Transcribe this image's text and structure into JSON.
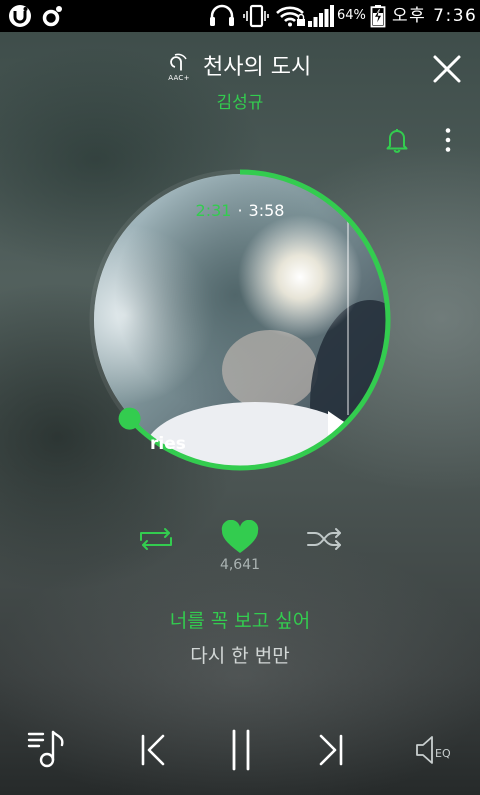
{
  "status_bar": {
    "battery_percent": "64%",
    "time": "오후 7:36",
    "icons": [
      "u-plus-icon",
      "music-notification-icon",
      "headset-icon",
      "phone-vibrate-icon",
      "wifi-lock-icon",
      "signal-icon",
      "battery-charging-icon"
    ]
  },
  "header": {
    "codec_badge": "AAC+",
    "song_title": "천사의 도시",
    "artist": "김성규",
    "icons": [
      "aac-icon",
      "close-icon",
      "bell-icon",
      "more-vertical-icon"
    ]
  },
  "player": {
    "elapsed": "2:31",
    "separator": "·",
    "duration": "3:58",
    "progress": 0.634,
    "album_art_text": "ries"
  },
  "controls": {
    "repeat_active": true,
    "liked": true,
    "shuffle_active": false,
    "like_count": "4,641",
    "icons": [
      "repeat-icon",
      "heart-icon",
      "shuffle-icon"
    ]
  },
  "lyrics": {
    "current_line": "너를 꼭 보고 싶어",
    "next_line": "다시 한 번만"
  },
  "bottom_bar": {
    "eq_label": "EQ",
    "icons": [
      "playlist-icon",
      "previous-icon",
      "pause-icon",
      "next-icon",
      "speaker-eq-icon"
    ]
  },
  "colors": {
    "accent": "#33cc4f",
    "inactive": "#c0c8c8",
    "muted_text": "#aab3b2",
    "status_bar_bg": "#000000"
  }
}
